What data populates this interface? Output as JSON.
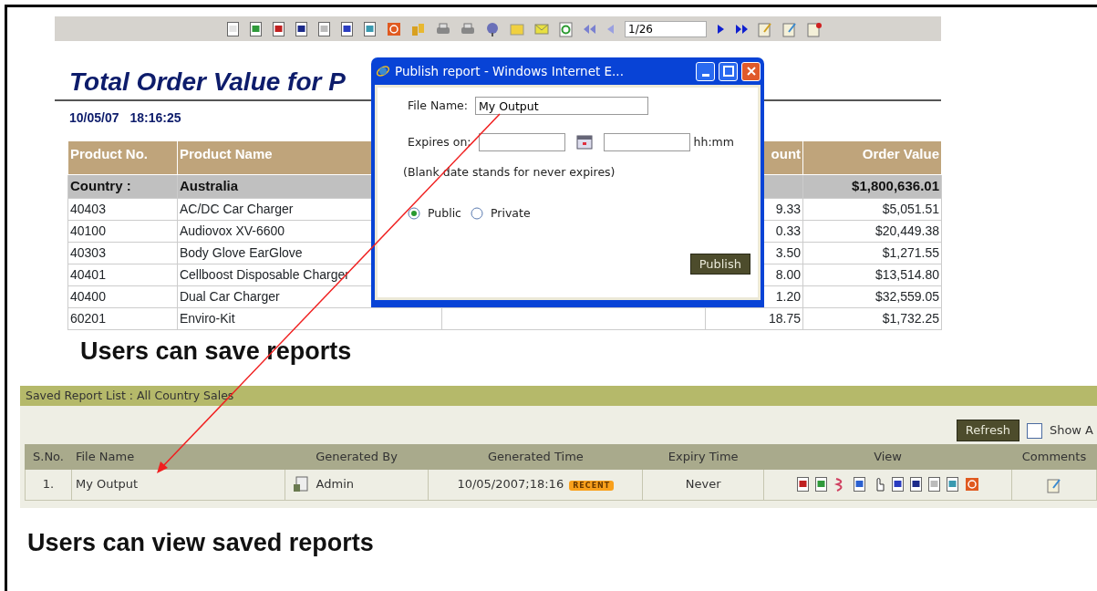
{
  "toolbar": {
    "page_field": {
      "value": "1/26"
    }
  },
  "report": {
    "title": "Total Order Value for P",
    "date": "10/05/07",
    "time": "18:16:25",
    "header": {
      "product_no": "Product No.",
      "product_name": "Product Name",
      "column_5": "ount",
      "order_value": "Order Value"
    },
    "group": {
      "label": "Country :",
      "value": "Australia",
      "total": "$1,800,636.01"
    },
    "rows": [
      {
        "product_no": "40403",
        "product_name": "AC/DC  Car Charger",
        "column_5": "9.33",
        "order_value": "$5,051.51"
      },
      {
        "product_no": "40100",
        "product_name": "Audiovox XV-6600",
        "column_5": "0.33",
        "order_value": "$20,449.38"
      },
      {
        "product_no": "40303",
        "product_name": "Body Glove EarGlove",
        "column_5": "3.50",
        "order_value": "$1,271.55"
      },
      {
        "product_no": "40401",
        "product_name": "Cellboost Disposable Charger",
        "column_5": "8.00",
        "order_value": "$13,514.80"
      },
      {
        "product_no": "40400",
        "product_name": "Dual Car Charger",
        "column_5": "1.20",
        "order_value": "$32,559.05"
      },
      {
        "product_no": "60201",
        "product_name": "Enviro-Kit",
        "column_5": "18.75",
        "order_value": "$1,732.25"
      }
    ]
  },
  "dialog": {
    "title": "Publish report - Windows Internet E...",
    "file_name": {
      "label": "File Name:",
      "value": "My Output"
    },
    "expires": {
      "label": "Expires on:",
      "time_unit": "hh:mm"
    },
    "note": "(Blank date stands for never expires)",
    "visibility": [
      {
        "label": "Public",
        "selected": true
      },
      {
        "label": "Private",
        "selected": false
      }
    ],
    "publish_button": "Publish"
  },
  "save_caption": "Users can save reports",
  "saved_list": {
    "title": "Saved Report List : All Country Sales",
    "refresh_button": "Refresh",
    "show_all": {
      "label": "Show A",
      "checked": false
    },
    "columns": [
      "S.No.",
      "File Name",
      "Generated By",
      "Generated Time",
      "Expiry Time",
      "View",
      "Comments"
    ],
    "rows": [
      {
        "sno": "1.",
        "file_name": "My Output",
        "generated_by": "Admin",
        "generated_time": "10/05/2007;18:16",
        "badge": "RECENT",
        "expiry_time": "Never"
      }
    ]
  },
  "view_caption": "Users can view saved reports"
}
